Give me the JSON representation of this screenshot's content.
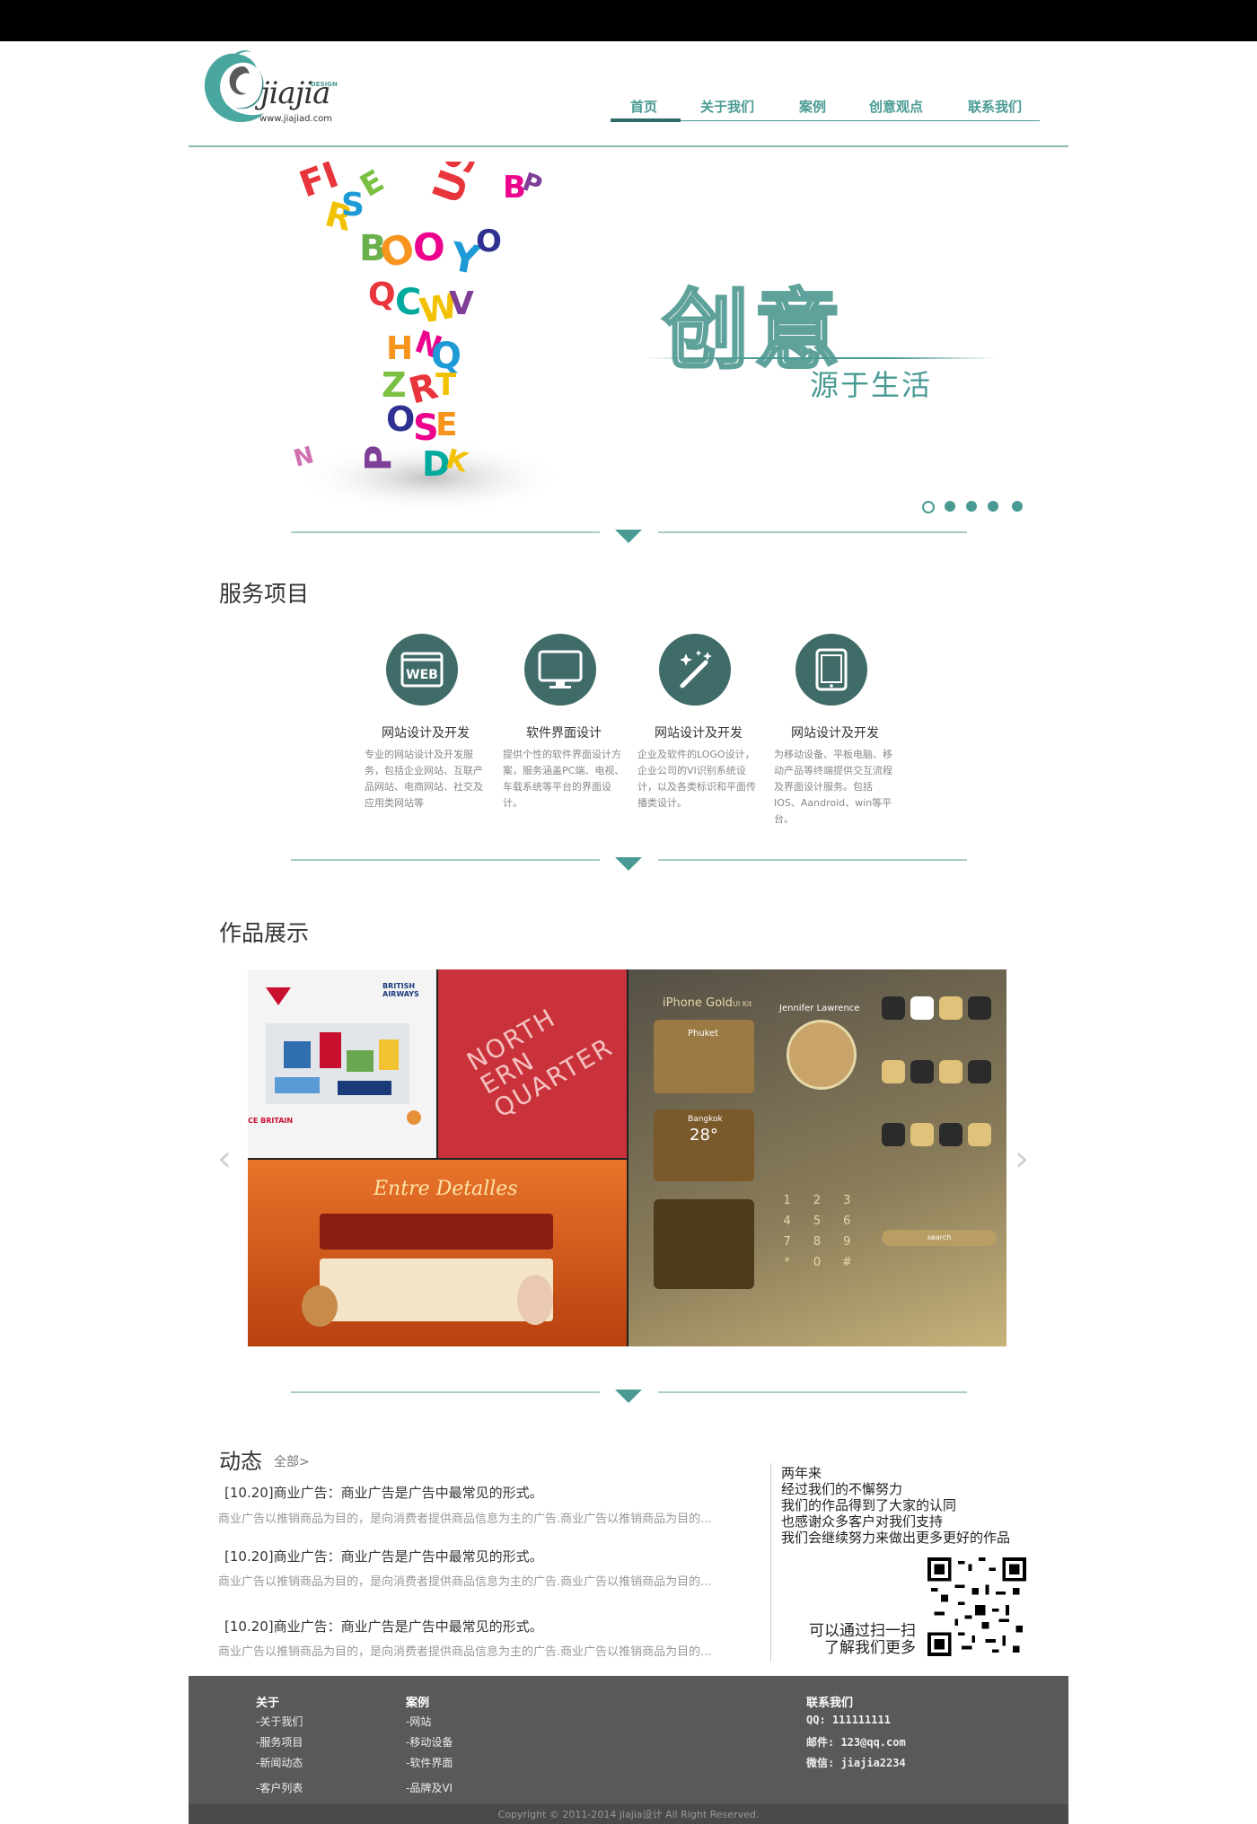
{
  "header": {
    "logo_word": "jiajia",
    "logo_design": "DESIGN",
    "logo_url": "www.jiajiad.com",
    "nav": [
      "首页",
      "关于我们",
      "案例",
      "创意观点",
      "联系我们"
    ]
  },
  "hero": {
    "title": "创意",
    "subtitle": "源于生活",
    "slide_count": 5,
    "active_slide": 1
  },
  "services": {
    "title": "服务项目",
    "items": [
      {
        "icon": "web-icon",
        "name": "网站设计及开发",
        "desc": "专业的网站设计及开发服务，包括企业网站、互联产品网站、电商网站、社交及应用类网站等"
      },
      {
        "icon": "monitor-icon",
        "name": "软件界面设计",
        "desc": "提供个性的软件界面设计方案，服务涵盖PC端、电视、车载系统等平台的界面设计。"
      },
      {
        "icon": "magic-wand-icon",
        "name": "网站设计及开发",
        "desc": "企业及软件的LOGO设计，企业公司的VI识别系统设计，以及各类标识和平面传播类设计。"
      },
      {
        "icon": "tablet-icon",
        "name": "网站设计及开发",
        "desc": "为移动设备、平板电脑、移动产品等终端提供交互流程及界面设计服务。包括IOS、Aandroid、win等平台。"
      }
    ]
  },
  "works": {
    "title": "作品展示",
    "ba_label": "BRITISH AIRWAYS",
    "ba_sub": "CE BRITAIN",
    "north": [
      "NORTH",
      "ERN",
      "QUARTER"
    ],
    "entre_detalles": "Entre Detalles",
    "iphone_title": "iPhone Gold",
    "iphone_sub": "UI Kit",
    "jennifer": "Jennifer Lawrence",
    "phuket": "Phuket",
    "bangkok": "Bangkok",
    "temp": "28°",
    "keypad": [
      "1",
      "2",
      "3",
      "4",
      "5",
      "6",
      "7",
      "8",
      "9",
      "*",
      "0",
      "#"
    ],
    "search_label": "search"
  },
  "news": {
    "title": "动态",
    "all_link": "全部>",
    "items": [
      {
        "title": "[10.20]商业广告：商业广告是广告中最常见的形式。",
        "desc": "商业广告以推销商品为目的，是向消费者提供商品信息为主的广告.商业广告以推销商品为目的..."
      },
      {
        "title": "[10.20]商业广告：商业广告是广告中最常见的形式。",
        "desc": "商业广告以推销商品为目的，是向消费者提供商品信息为主的广告.商业广告以推销商品为目的..."
      },
      {
        "title": "[10.20]商业广告：商业广告是广告中最常见的形式。",
        "desc": "商业广告以推销商品为目的，是向消费者提供商品信息为主的广告.商业广告以推销商品为目的..."
      }
    ],
    "quote": [
      "两年来",
      "经过我们的不懈努力",
      "我们的作品得到了大家的认同",
      "也感谢众多客户对我们支持",
      "我们会继续努力来做出更多更好的作品"
    ],
    "scan": [
      "可以通过扫一扫",
      "了解我们更多"
    ]
  },
  "footer": {
    "col1": {
      "head": "关于",
      "links": [
        "-关于我们",
        "-服务项目",
        "-新闻动态",
        "-客户列表"
      ]
    },
    "col2": {
      "head": "案例",
      "links": [
        "-网站",
        "-移动设备",
        "-软件界面",
        "-品牌及VI"
      ]
    },
    "contact": {
      "head": "联系我们",
      "qq": "QQ: 111111111",
      "email": "邮件: 123@qq.com",
      "wechat": "微信: jiajia2234"
    },
    "copyright": "Copyright © 2011-2014 jiajia设计 All Right Reserved."
  },
  "colors": {
    "accent": "#4a9a94",
    "dark_teal": "#3f6b68",
    "footer_bg": "#595959"
  }
}
